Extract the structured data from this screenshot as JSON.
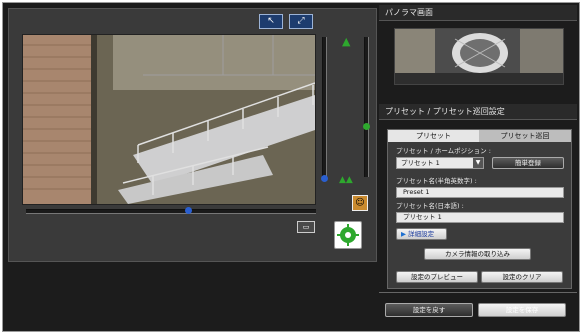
{
  "panorama": {
    "title": "パノラマ画面"
  },
  "preset_section": {
    "title": "プリセット / プリセット巡回設定"
  },
  "tabs": [
    {
      "label": "プリセット"
    },
    {
      "label": "プリセット巡回"
    }
  ],
  "preset": {
    "home_position_label": "プリセット / ホームポジション :",
    "selected_value": "プリセット 1",
    "quick_register_label": "簡単登録",
    "name_ascii_label": "プリセット名(半角英数字) :",
    "name_ascii_value": "Preset 1",
    "name_japanese_label": "プリセット名(日本語) :",
    "name_japanese_value": "プリセット 1",
    "advanced_label": "詳細設定",
    "import_camera_label": "カメラ情報の取り込み",
    "preview_label": "設定のプレビュー",
    "clear_label": "設定のクリア"
  },
  "footer": {
    "restore_label": "設定を戻す",
    "save_label": "設定を保存"
  },
  "colors": {
    "accent_green": "#2ea82e",
    "knob_blue": "#2a5fd0",
    "tab_active": "#e6e6e6",
    "tab_inactive": "#bdbdbd"
  }
}
